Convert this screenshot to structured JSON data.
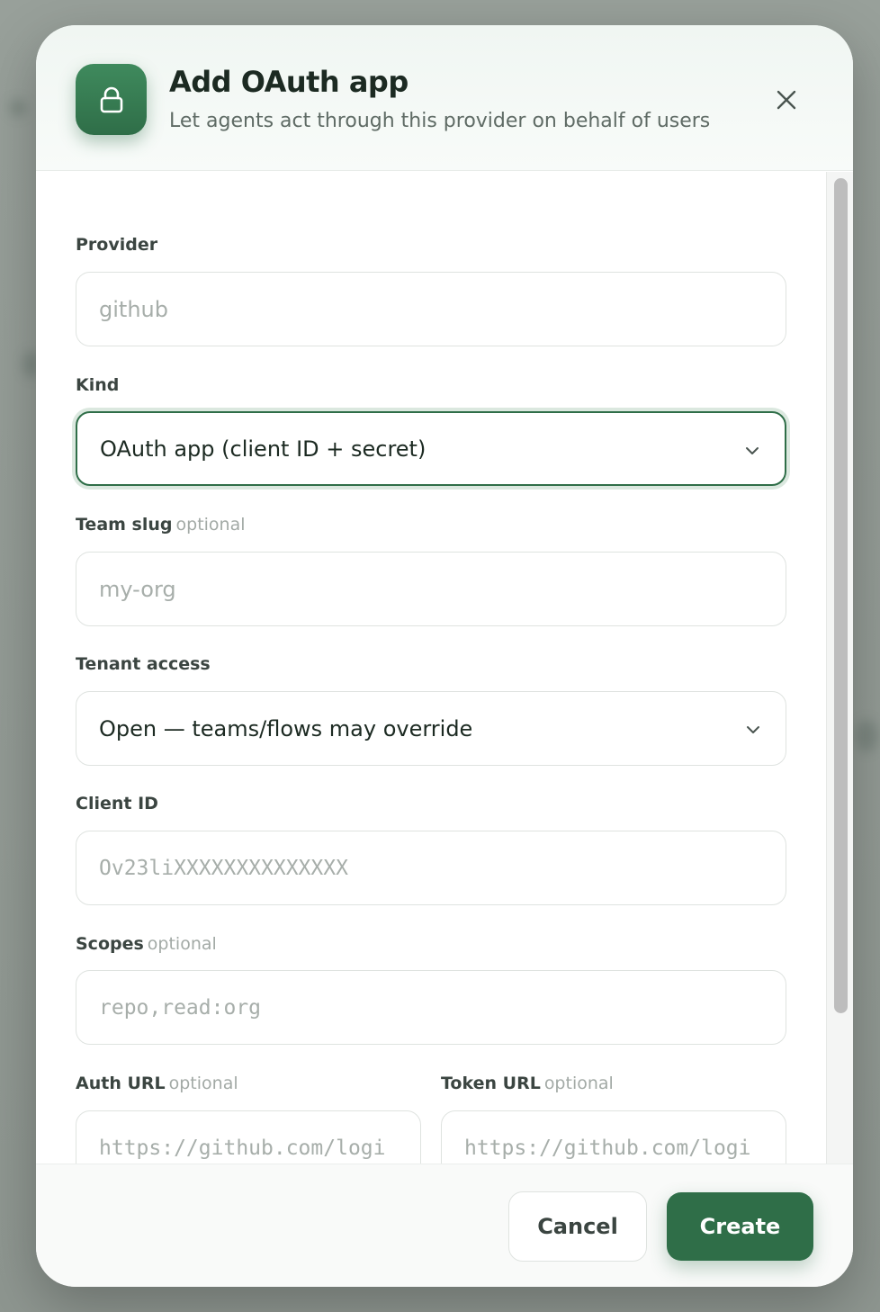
{
  "dialog": {
    "title": "Add OAuth app",
    "subtitle": "Let agents act through this provider on behalf of users",
    "icon": "lock-icon",
    "close_icon": "close-icon"
  },
  "form": {
    "provider": {
      "label": "Provider",
      "placeholder": "github",
      "value": ""
    },
    "kind": {
      "label": "Kind",
      "selected": "OAuth app (client ID + secret)"
    },
    "team_slug": {
      "label": "Team slug",
      "optional": "optional",
      "placeholder": "my-org",
      "value": ""
    },
    "tenant_access": {
      "label": "Tenant access",
      "selected": "Open — teams/flows may override"
    },
    "client_id": {
      "label": "Client ID",
      "placeholder": "Ov23liXXXXXXXXXXXXXX",
      "value": ""
    },
    "scopes": {
      "label": "Scopes",
      "optional": "optional",
      "placeholder": "repo,read:org",
      "value": ""
    },
    "auth_url": {
      "label": "Auth URL",
      "optional": "optional",
      "placeholder": "https://github.com/logi"
    },
    "token_url": {
      "label": "Token URL",
      "optional": "optional",
      "placeholder": "https://github.com/logi"
    }
  },
  "footer": {
    "cancel_label": "Cancel",
    "create_label": "Create"
  },
  "colors": {
    "accent": "#2f6e48",
    "focus_ring": "#dbe8df"
  }
}
